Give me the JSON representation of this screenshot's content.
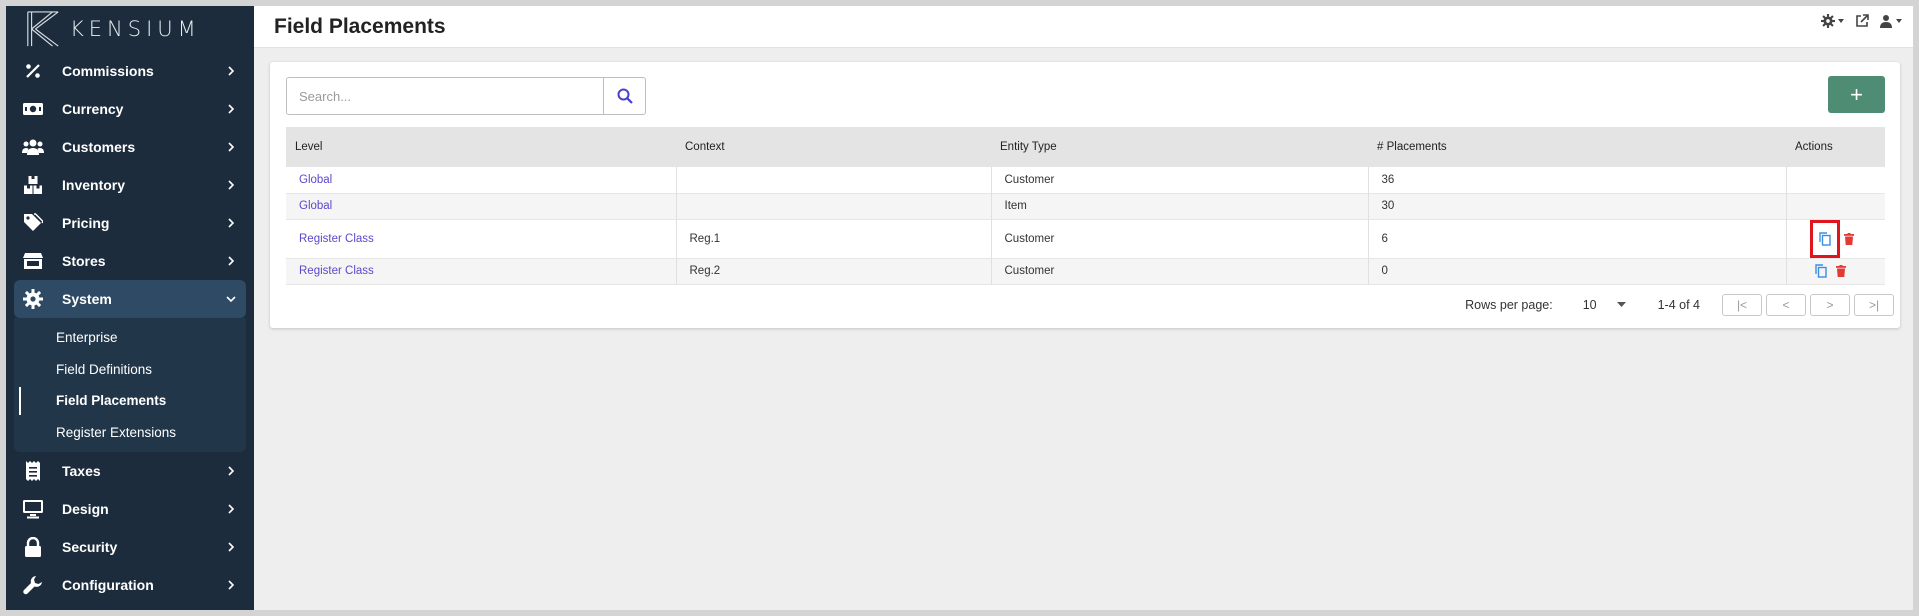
{
  "brand": {
    "name": "KENSIUM"
  },
  "sidebar": {
    "items": [
      {
        "label": "Commissions",
        "icon": "percent-icon"
      },
      {
        "label": "Currency",
        "icon": "money-icon"
      },
      {
        "label": "Customers",
        "icon": "users-icon"
      },
      {
        "label": "Inventory",
        "icon": "boxes-icon"
      },
      {
        "label": "Pricing",
        "icon": "tags-icon"
      },
      {
        "label": "Stores",
        "icon": "store-icon"
      },
      {
        "label": "System",
        "icon": "gear-icon",
        "expanded": true
      },
      {
        "label": "Taxes",
        "icon": "receipt-icon"
      },
      {
        "label": "Design",
        "icon": "monitor-icon"
      },
      {
        "label": "Security",
        "icon": "lock-icon"
      },
      {
        "label": "Configuration",
        "icon": "wrench-icon"
      }
    ],
    "system_sub": [
      {
        "label": "Enterprise"
      },
      {
        "label": "Field Definitions"
      },
      {
        "label": "Field Placements",
        "current": true
      },
      {
        "label": "Register Extensions"
      }
    ]
  },
  "header": {
    "title": "Field Placements"
  },
  "search": {
    "placeholder": "Search...",
    "value": ""
  },
  "add_button": {
    "label": "+"
  },
  "table": {
    "columns": [
      "Level",
      "Context",
      "Entity Type",
      "# Placements",
      "Actions"
    ],
    "rows": [
      {
        "level": "Global",
        "context": "",
        "entity_type": "Customer",
        "placements": "36",
        "actions": false
      },
      {
        "level": "Global",
        "context": "",
        "entity_type": "Item",
        "placements": "30",
        "actions": false
      },
      {
        "level": "Register Class",
        "context": "Reg.1",
        "entity_type": "Customer",
        "placements": "6",
        "actions": true,
        "highlight": true
      },
      {
        "level": "Register Class",
        "context": "Reg.2",
        "entity_type": "Customer",
        "placements": "0",
        "actions": true
      }
    ]
  },
  "pagination": {
    "rows_per_page_label": "Rows per page:",
    "rows_per_page": "10",
    "range": "1-4 of 4",
    "first": "|<",
    "prev": "<",
    "next": ">",
    "last": ">|"
  },
  "colors": {
    "sidebar_bg": "#1c2c3c",
    "accent_green": "#4e8c74",
    "link": "#5a49c9",
    "copy_icon": "#3a8ee6",
    "delete_icon": "#e53935",
    "highlight": "#e0141c"
  }
}
